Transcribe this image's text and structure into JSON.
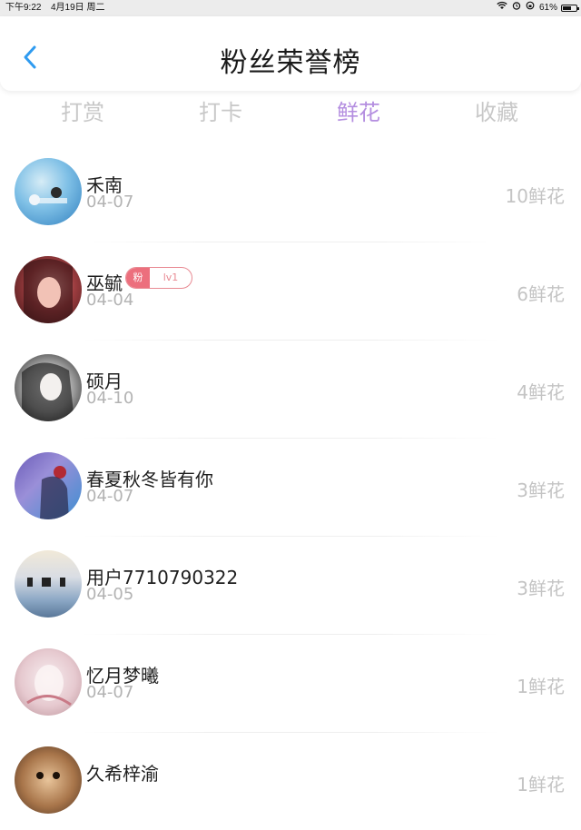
{
  "status": {
    "time": "下午9:22",
    "date": "4月19日 周二",
    "battery": "61%",
    "battery_level": 0.61
  },
  "header": {
    "title": "粉丝荣誉榜"
  },
  "tabs": [
    {
      "label": "打赏",
      "active": false
    },
    {
      "label": "打卡",
      "active": false
    },
    {
      "label": "鲜花",
      "active": true
    },
    {
      "label": "收藏",
      "active": false
    }
  ],
  "rows": [
    {
      "name": "禾南",
      "date": "04-07",
      "amount": "10鲜花",
      "avatar": "sky-blue"
    },
    {
      "name": "巫毓",
      "date": "04-04",
      "amount": "6鲜花",
      "avatar": "dark-red",
      "badge": {
        "left": "粉",
        "right": "lv1"
      }
    },
    {
      "name": "硕月",
      "date": "04-10",
      "amount": "4鲜花",
      "avatar": "monochrome"
    },
    {
      "name": "春夏秋冬皆有你",
      "date": "04-07",
      "amount": "3鲜花",
      "avatar": "purple-blue"
    },
    {
      "name": "用户7710790322",
      "date": "04-05",
      "amount": "3鲜花",
      "avatar": "sea"
    },
    {
      "name": "忆月梦曦",
      "date": "04-07",
      "amount": "1鲜花",
      "avatar": "pink-pale"
    },
    {
      "name": "久希梓渝",
      "date": "",
      "amount": "1鲜花",
      "avatar": "warm-brown"
    }
  ],
  "colors": {
    "accent": "#b48ee0",
    "back_arrow": "#2f9bf0",
    "badge_pink": "#ec6f7d"
  }
}
